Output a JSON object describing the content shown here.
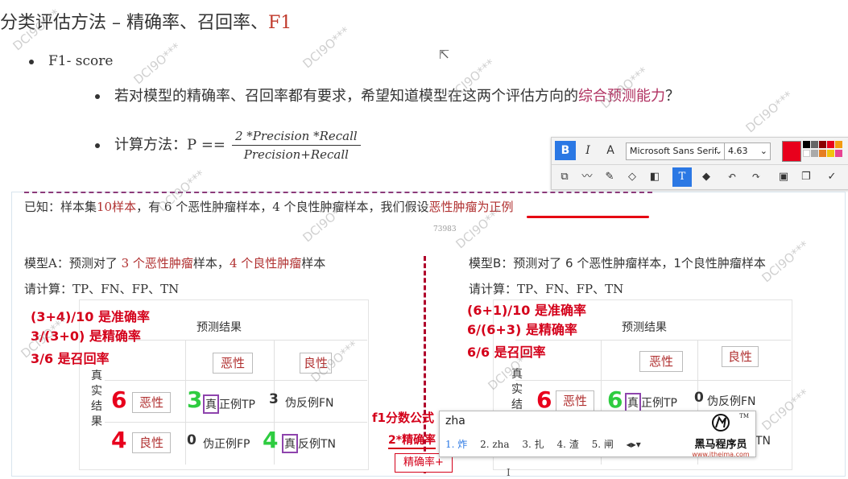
{
  "slide": {
    "title": "分类评估方法  –  精确率、召回率、",
    "title_f1": "F1",
    "bullet_f1": "F1- score",
    "bullet_desc": "若对模型的精确率、召回率都有要求，希望知道模型在这两个评估方向的",
    "bullet_desc_highlight": "综合预测能力",
    "bullet_desc_end": "？",
    "calc_label": "计算方法：P  ==",
    "formula_num": "2 *Precision *Recall",
    "formula_den": "Precision+Recall"
  },
  "toolbar": {
    "bold": "B",
    "italic": "I",
    "font_name": "Microsoft Sans Serif",
    "font_size": "4.63",
    "active_color": "#e8001c",
    "row2_icons": [
      "select-icon",
      "curve-icon",
      "pencil-icon",
      "highlighter-icon",
      "mosaic-icon",
      "text-icon",
      "eraser-icon",
      "undo-icon",
      "redo-icon",
      "save-icon",
      "copy-icon",
      "check-icon"
    ]
  },
  "panel": {
    "known_prefix": "已知：样本集",
    "known_count": "10样本",
    "known_mid": "，有 6 个恶性肿瘤样本，4 个良性肿瘤样本，我们假设",
    "known_assume": "恶性肿瘤为正例",
    "faint_num": "73983",
    "modelA_text": "模型A：预测对了 ",
    "modelA_3": "3 个恶性肿瘤",
    "modelA_mid": "样本，",
    "modelA_4": "4 个良性肿瘤",
    "modelA_end": "样本",
    "modelB_text": "模型B：预测对了 6 个恶性肿瘤样本，1个良性肿瘤样本",
    "calcA": "请计算：TP、FN、FP、TN",
    "calcB": "请计算：TP、FN、FP、TN"
  },
  "annotations": {
    "a1": "(3+4)/10 是准确率",
    "a2": "3/(3+0) 是精确率",
    "a3": "3/6 是召回率",
    "b1": "(6+1)/10 是准确率",
    "b2": "6/(6+3) 是精确率",
    "b3": "6/6 是召回率",
    "f1_note": "f1分数公式",
    "f1_formula": "2*精确率",
    "precision_box": "精确率+"
  },
  "matrixA": {
    "pred_title": "预测结果",
    "col_malignant": "恶性",
    "col_benign": "良性",
    "real_label": "真实结果",
    "row1_num": "6",
    "row1_label": "恶性",
    "tp_num": "3",
    "tp_text": "真",
    "tp_rest": "正例TP",
    "fn_num": "3",
    "fn_text": "伪反例FN",
    "row2_num": "4",
    "row2_label": "良性",
    "fp_num": "0",
    "fp_text": "伪正例FP",
    "tn_num": "4",
    "tn_text": "真",
    "tn_rest": "反例TN"
  },
  "matrixB": {
    "pred_title": "预测结果",
    "col_malignant": "恶性",
    "col_benign": "良性",
    "real_label": "真实结果",
    "row1_num": "6",
    "row1_label": "恶性",
    "tp_num": "6",
    "tp_text": "真",
    "tp_rest": "正例TP",
    "fn_num": "0",
    "fn_text": "伪反例FN",
    "tn_rest": "TN"
  },
  "ime": {
    "input": "zha",
    "candidates": [
      "1. 炸",
      "2. zha",
      "3. 扎",
      "4. 渣",
      "5. 闸"
    ],
    "logo_name": "黑马程序员",
    "logo_url": "www.itheima.com",
    "logo_tm": "TM"
  },
  "watermark": "DCI9O***"
}
